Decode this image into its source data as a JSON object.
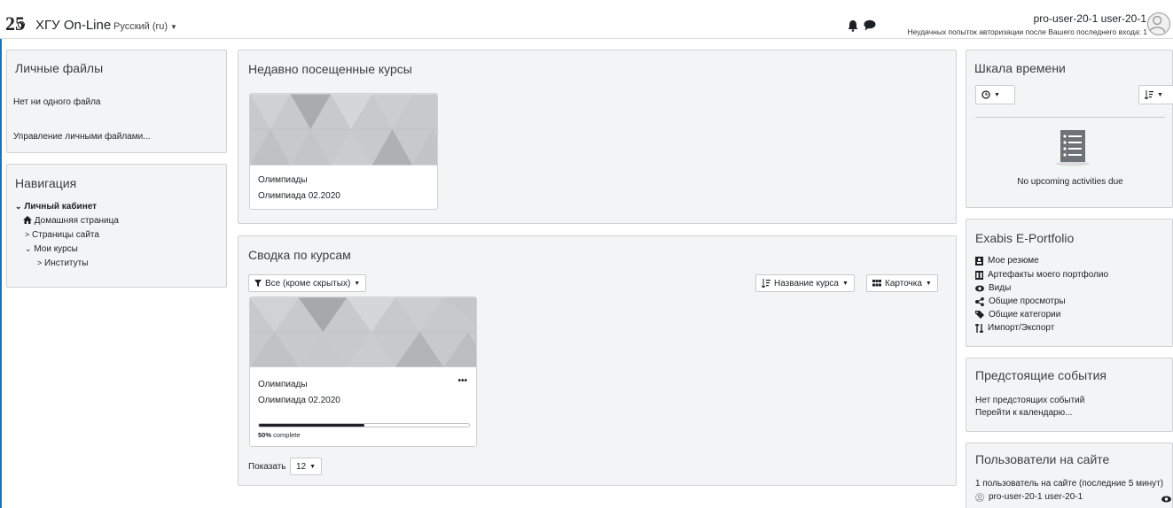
{
  "header": {
    "logo_text": "25",
    "brand": "ХГУ On-Line",
    "language": "Русский (ru)",
    "username": "pro-user-20-1 user-20-1",
    "login_warning": "Неудачных попыток авторизации после Вашего последнего входа: 1",
    "icons": [
      "bell-icon",
      "chat-icon",
      "avatar-icon"
    ]
  },
  "private_files": {
    "title": "Личные файлы",
    "empty": "Нет ни одного файла",
    "manage_link": "Управление личными файлами..."
  },
  "navigation": {
    "title": "Навигация",
    "items": [
      {
        "label": "Личный кабинет",
        "icon": "chevron-down-icon"
      },
      {
        "label": "Домашняя страница",
        "icon": "home-icon"
      },
      {
        "label": "Страницы сайта",
        "icon": "chevron-right-icon"
      },
      {
        "label": "Мои курсы",
        "icon": "chevron-down-icon"
      },
      {
        "label": "Институты",
        "icon": "chevron-right-icon"
      }
    ]
  },
  "recent": {
    "title": "Недавно посещенные курсы",
    "card": {
      "category": "Олимпиады",
      "name": "Олимпиада 02.2020"
    }
  },
  "overview": {
    "title": "Сводка по курсам",
    "filter": "Все (кроме скрытых)",
    "sort": "Название курса",
    "view": "Карточка",
    "card": {
      "category": "Олимпиады",
      "name": "Олимпиада 02.2020",
      "menu": "•••",
      "progress_pct": "50%",
      "progress_text": " complete",
      "progress_value": 0.5
    },
    "show_label": "Показать",
    "page_size": "12"
  },
  "timeline": {
    "title": "Шкала времени",
    "empty": "No upcoming activities due",
    "icons": [
      "clock-icon",
      "sort-icon",
      "list-doc-icon"
    ]
  },
  "portfolio": {
    "title": "Exabis E-Portfolio",
    "items": [
      {
        "label": "Мое резюме",
        "icon": "resume-icon"
      },
      {
        "label": "Артефакты моего портфолио",
        "icon": "artifacts-icon"
      },
      {
        "label": "Виды",
        "icon": "eye-icon"
      },
      {
        "label": "Общие просмотры",
        "icon": "share-icon"
      },
      {
        "label": "Общие категории",
        "icon": "tags-icon"
      },
      {
        "label": "Импорт/Экспорт",
        "icon": "import-export-icon"
      }
    ]
  },
  "events": {
    "title": "Предстоящие события",
    "empty": "Нет предстоящих событий",
    "calendar_link": "Перейти к календарю..."
  },
  "online": {
    "title": "Пользователи на сайте",
    "summary": "1 пользователь на сайте (последние 5 минут)",
    "user": "pro-user-20-1 user-20-1"
  },
  "colors": {
    "accent": "#1a73b8",
    "block_bg": "#f3f4f5",
    "progress": "#1d2125"
  }
}
